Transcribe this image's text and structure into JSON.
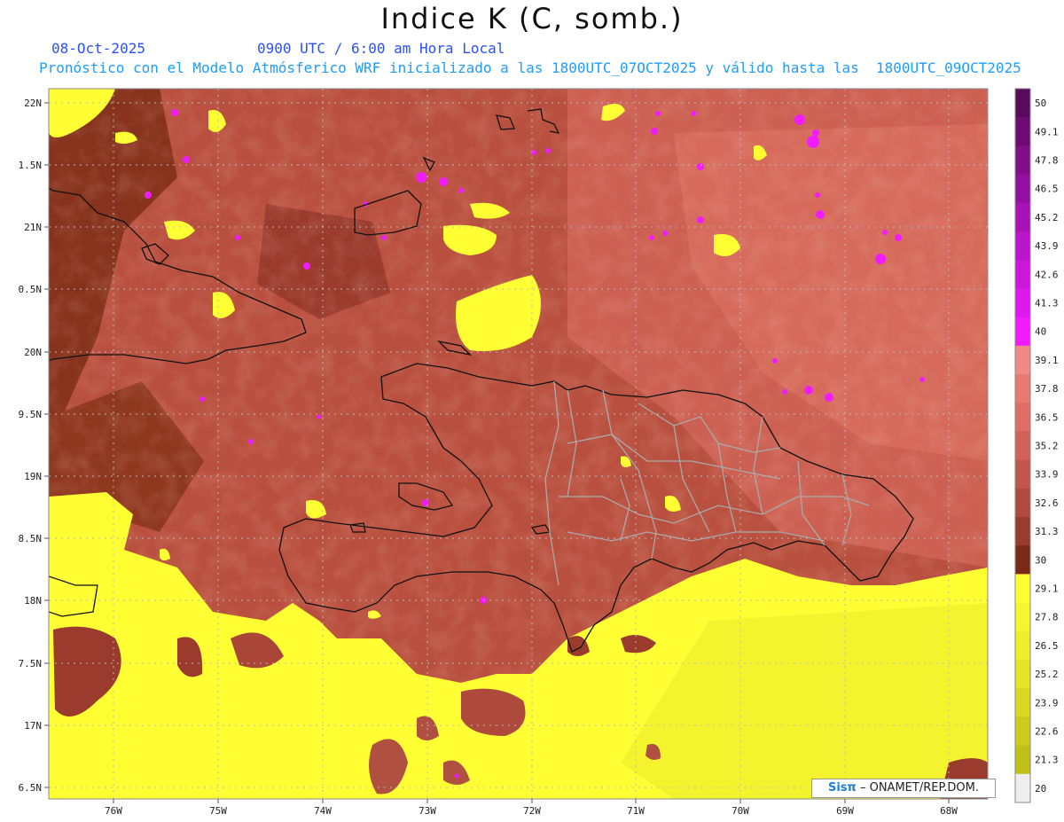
{
  "header": {
    "title": "Indice K (C, somb.)",
    "date": "08-Oct-2025",
    "time": "0900 UTC / 6:00 am Hora Local",
    "run_info": "Pronóstico con el Modelo Atmósferico WRF inicializado a las 1800UTC_07OCT2025 y válido hasta las  1800UTC_09OCT2025"
  },
  "map": {
    "lat_labels": [
      "22N",
      "1.5N",
      "21N",
      "0.5N",
      "20N",
      "9.5N",
      "19N",
      "8.5N",
      "18N",
      "7.5N",
      "17N",
      "6.5N"
    ],
    "lon_labels": [
      "76W",
      "75W",
      "74W",
      "73W",
      "72W",
      "71W",
      "70W",
      "69W",
      "68W"
    ],
    "gridlines": "dotted",
    "field": "K index (C), shaded"
  },
  "legend": {
    "levels": [
      "50",
      "49.1",
      "47.8",
      "46.5",
      "45.2",
      "43.9",
      "42.6",
      "41.3",
      "40",
      "39.1",
      "37.8",
      "36.5",
      "35.2",
      "33.9",
      "32.6",
      "31.3",
      "30",
      "29.1",
      "27.8",
      "26.5",
      "25.2",
      "23.9",
      "22.6",
      "21.3",
      "20"
    ],
    "colors": [
      "#5a0a5c",
      "#6e0c74",
      "#820f8a",
      "#9410a0",
      "#a812b6",
      "#bb14ca",
      "#cc16dc",
      "#de18ee",
      "#f01cff",
      "#f08a86",
      "#e97a72",
      "#df6e64",
      "#d06258",
      "#c1574c",
      "#ae4a3e",
      "#9a3b2e",
      "#7a2a16",
      "#ffff33",
      "#f6f62e",
      "#eeee2a",
      "#e4e426",
      "#d8d822",
      "#cccc1e",
      "#c0c01a",
      "#eeeeee"
    ]
  },
  "credit": {
    "brand": "Sisπ",
    "text": "– ONAMET/REP.DOM."
  }
}
